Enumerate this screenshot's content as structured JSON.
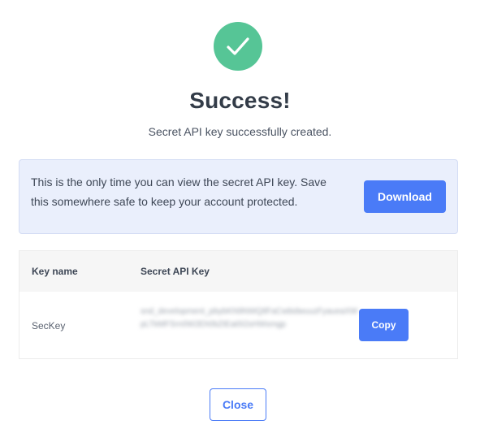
{
  "header": {
    "icon": "checkmark-icon",
    "title": "Success!",
    "subtitle": "Secret API key successfully created."
  },
  "notice": {
    "text": "This is the only time you can view the secret API key. Save this somewhere safe to keep your account protected.",
    "download_label": "Download"
  },
  "table": {
    "columns": [
      "Key name",
      "Secret API Key"
    ],
    "rows": [
      {
        "key_name": "SecKey",
        "secret_key": "snd_development_pbybKN9NWQtlFaCwbidwuuzFyaueaXWpLTkMFSrn0W2Eh0bZtEai0I2sHWsmgp",
        "copy_label": "Copy"
      }
    ]
  },
  "footer": {
    "close_label": "Close"
  },
  "colors": {
    "success_green": "#56c596",
    "accent_blue": "#4a7bf7",
    "notice_bg": "#eaeffc"
  }
}
